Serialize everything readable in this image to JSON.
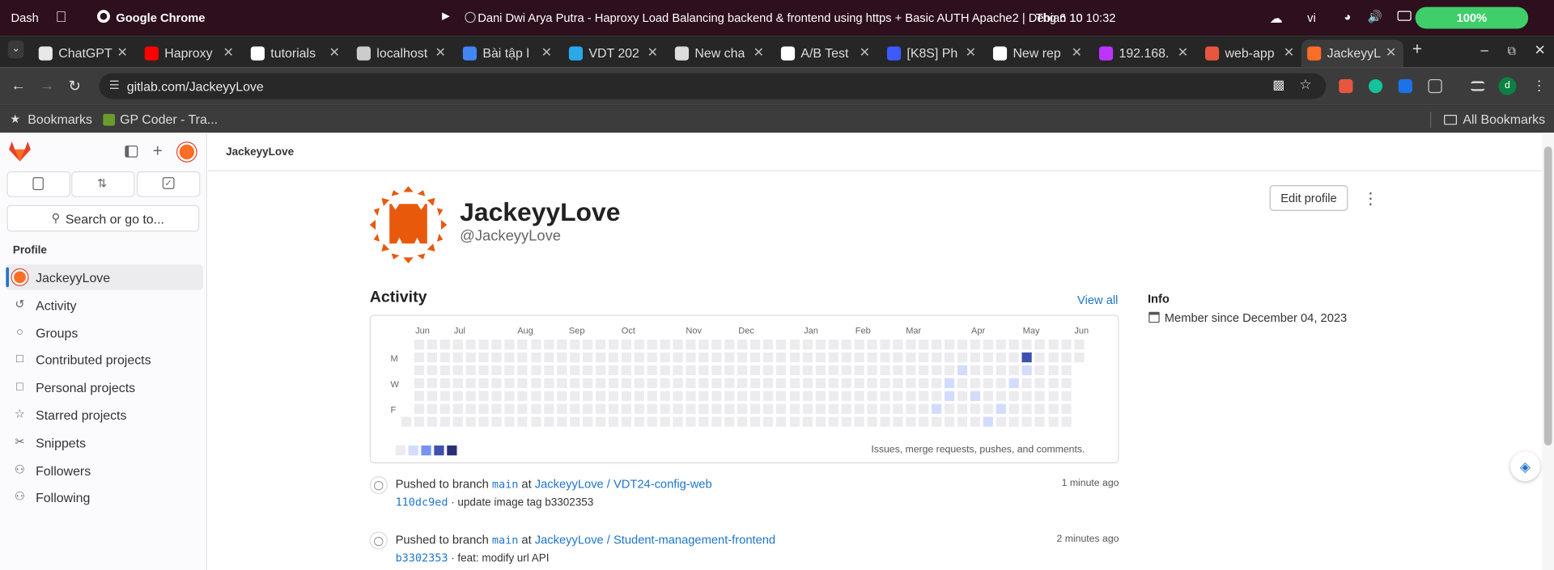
{
  "os_bar": {
    "activities": "Dash",
    "app_name": "Google Chrome",
    "window_title": "Dani Dwi Arya Putra - Haproxy Load Balancing backend & frontend using https + Basic AUTH   Apache2 | Debian 10",
    "datetime": "Thg 6 10  10:32",
    "input_method": "vi",
    "battery": "100%"
  },
  "tabs": [
    {
      "label": "ChatGPT",
      "icon": "chatgpt-icon",
      "color": "#e8e8e8"
    },
    {
      "label": "Haproxy",
      "icon": "youtube-icon",
      "color": "#ff0000"
    },
    {
      "label": "tutorials",
      "icon": "github-icon",
      "color": "#ffffff"
    },
    {
      "label": "localhost",
      "icon": "globe-icon",
      "color": "#cccccc"
    },
    {
      "label": "Bài tập l",
      "icon": "docs-icon",
      "color": "#4285f4"
    },
    {
      "label": "VDT 202",
      "icon": "telegram-icon",
      "color": "#29a9eb"
    },
    {
      "label": "New cha",
      "icon": "chat-icon",
      "color": "#dddddd"
    },
    {
      "label": "A/B Test",
      "icon": "page-icon",
      "color": "#ffffff"
    },
    {
      "label": "[K8S] Ph",
      "icon": "v-icon",
      "color": "#3d5afe"
    },
    {
      "label": "New rep",
      "icon": "github-icon",
      "color": "#ffffff"
    },
    {
      "label": "192.168.",
      "icon": "vite-icon",
      "color": "#bd34fe"
    },
    {
      "label": "web-app",
      "icon": "app-icon",
      "color": "#e8563f"
    },
    {
      "label": "JackeyyL",
      "icon": "gitlab-icon",
      "color": "#fc6d26"
    }
  ],
  "address_bar": {
    "url": "gitlab.com/JackeyyLove"
  },
  "bookmarks_bar": {
    "bookmarks_label": "Bookmarks",
    "items": [
      "GP Coder - Tra..."
    ],
    "all_bookmarks": "All Bookmarks"
  },
  "sidebar": {
    "search_placeholder": "Search or go to...",
    "section_title": "Profile",
    "items": [
      {
        "label": "JackeyyLove",
        "icon": "avatar-icon",
        "selected": true
      },
      {
        "label": "Activity",
        "icon": "history-icon"
      },
      {
        "label": "Groups",
        "icon": "group-icon"
      },
      {
        "label": "Contributed projects",
        "icon": "project-icon"
      },
      {
        "label": "Personal projects",
        "icon": "project-icon"
      },
      {
        "label": "Starred projects",
        "icon": "star-icon"
      },
      {
        "label": "Snippets",
        "icon": "snippet-icon"
      },
      {
        "label": "Followers",
        "icon": "users-icon"
      },
      {
        "label": "Following",
        "icon": "users-icon"
      }
    ]
  },
  "breadcrumb": "JackeyyLove",
  "profile": {
    "name": "JackeyyLove",
    "username": "@JackeyyLove",
    "edit_button": "Edit profile"
  },
  "activity": {
    "title": "Activity",
    "view_all": "View all",
    "months": [
      "Jun",
      "Jul",
      "Aug",
      "Sep",
      "Oct",
      "Nov",
      "Dec",
      "Jan",
      "Feb",
      "Mar",
      "Apr",
      "May",
      "Jun"
    ],
    "days": [
      "M",
      "W",
      "F"
    ],
    "legend_text": "Issues, merge requests, pushes, and comments.",
    "colors": [
      "#ececef",
      "#d2dcff",
      "#7992f5",
      "#3f51ae",
      "#2a2f73"
    ],
    "highlights": [
      {
        "week": 48,
        "day": 1,
        "level": 3
      },
      {
        "week": 48,
        "day": 2,
        "level": 1
      },
      {
        "week": 43,
        "day": 2,
        "level": 1
      },
      {
        "week": 42,
        "day": 3,
        "level": 1
      },
      {
        "week": 47,
        "day": 3,
        "level": 1
      },
      {
        "week": 42,
        "day": 4,
        "level": 1
      },
      {
        "week": 44,
        "day": 4,
        "level": 1
      },
      {
        "week": 41,
        "day": 5,
        "level": 1
      },
      {
        "week": 46,
        "day": 5,
        "level": 1
      },
      {
        "week": 45,
        "day": 6,
        "level": 1
      },
      {
        "week": 47,
        "day": 7,
        "level": 2
      }
    ]
  },
  "info": {
    "title": "Info",
    "member_since": "Member since December 04, 2023"
  },
  "events": [
    {
      "action": "Pushed to branch",
      "branch": "main",
      "at": "at",
      "project": "JackeyyLove / VDT24-config-web",
      "commit": "110dc9ed",
      "message": "· update image tag b3302353",
      "time": "1 minute ago"
    },
    {
      "action": "Pushed to branch",
      "branch": "main",
      "at": "at",
      "project": "JackeyyLove / Student-management-frontend",
      "commit": "b3302353",
      "message": "· feat: modify url API",
      "time": "2 minutes ago"
    }
  ]
}
